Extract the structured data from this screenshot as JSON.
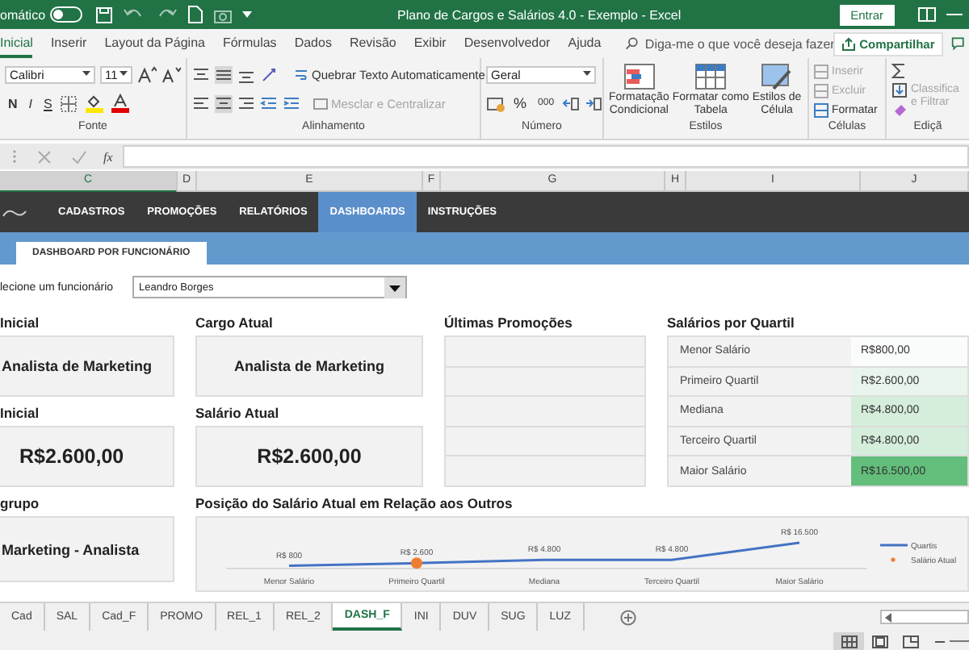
{
  "title_bar": {
    "autosave_label": "omático",
    "autosave_on": false,
    "title": "Plano de Cargos e Salários 4.0 - Exemplo  -  Excel",
    "sign_in": "Entrar"
  },
  "ribbon_tabs": [
    {
      "label": "Inicial",
      "selected": true
    },
    {
      "label": "Inserir",
      "selected": false
    },
    {
      "label": "Layout da Página",
      "selected": false
    },
    {
      "label": "Fórmulas",
      "selected": false
    },
    {
      "label": "Dados",
      "selected": false
    },
    {
      "label": "Revisão",
      "selected": false
    },
    {
      "label": "Exibir",
      "selected": false
    },
    {
      "label": "Desenvolvedor",
      "selected": false
    },
    {
      "label": "Ajuda",
      "selected": false
    }
  ],
  "tell_me": {
    "placeholder": "Diga-me o que você deseja fazer"
  },
  "share_button": "Compartilhar",
  "ribbon": {
    "font": {
      "name": "Calibri",
      "size": "11",
      "bold": "N",
      "italic": "I",
      "underline": "S",
      "label": "Fonte"
    },
    "alignment": {
      "wrap": "Quebrar Texto Automaticamente",
      "merge": "Mesclar e Centralizar",
      "merge_disabled": true,
      "label": "Alinhamento"
    },
    "number": {
      "format": "Geral",
      "percent": "%",
      "thousands": "000",
      "label": "Número"
    },
    "styles": {
      "items": [
        {
          "line1": "Formatação",
          "line2": "Condicional",
          "kind": "conditional"
        },
        {
          "line1": "Formatar como",
          "line2": "Tabela",
          "kind": "table"
        },
        {
          "line1": "Estilos de",
          "line2": "Célula",
          "kind": "cell"
        }
      ],
      "label": "Estilos"
    },
    "cells": {
      "items": [
        {
          "label": "Inserir",
          "disabled": true
        },
        {
          "label": "Excluir",
          "disabled": true
        },
        {
          "label": "Formatar",
          "disabled": false
        }
      ],
      "label": "Células"
    },
    "editing": {
      "sort_line1": "Classifica",
      "sort_line2": "e Filtrar",
      "sort_disabled": true,
      "label": "Ediçã"
    }
  },
  "formula_bar": {
    "fx": "fx"
  },
  "column_headers": [
    {
      "label": "C",
      "selected": true
    },
    {
      "label": "D",
      "selected": false
    },
    {
      "label": "E",
      "selected": false
    },
    {
      "label": "F",
      "selected": false
    },
    {
      "label": "G",
      "selected": false
    },
    {
      "label": "H",
      "selected": false
    },
    {
      "label": "I",
      "selected": false
    },
    {
      "label": "J",
      "selected": false
    }
  ],
  "nav": [
    {
      "label": "CADASTROS",
      "selected": false
    },
    {
      "label": "PROMOÇÕES",
      "selected": false
    },
    {
      "label": "RELATÓRIOS",
      "selected": false
    },
    {
      "label": "DASHBOARDS",
      "selected": true
    },
    {
      "label": "INSTRUÇÕES",
      "selected": false
    }
  ],
  "subtabs": [
    {
      "label": "DASHBOARD POR FUNCIONÁRIO",
      "selected": true
    }
  ],
  "selector": {
    "label": "lecione um funcionário",
    "value": "Leandro Borges"
  },
  "left_cards": [
    {
      "heading": "Inicial",
      "value": "Analista de Marketing",
      "kind": "text"
    },
    {
      "heading": "Inicial",
      "value": "R$2.600,00",
      "kind": "money"
    },
    {
      "heading": "grupo",
      "value": "Marketing - Analista",
      "kind": "text"
    }
  ],
  "middle_cards": [
    {
      "heading": "Cargo Atual",
      "value": "Analista de Marketing",
      "kind": "text"
    },
    {
      "heading": "Salário Atual",
      "value": "R$2.600,00",
      "kind": "money"
    }
  ],
  "promotions": {
    "heading": "Últimas Promoções"
  },
  "quartiles": {
    "heading": "Salários por Quartil",
    "rows": [
      {
        "label": "Menor Salário",
        "value": "R$800,00",
        "color": "#fafcfb"
      },
      {
        "label": "Primeiro Quartil",
        "value": "R$2.600,00",
        "color": "#e9f5ec"
      },
      {
        "label": "Mediana",
        "value": "R$4.800,00",
        "color": "#d5eddb"
      },
      {
        "label": "Terceiro Quartil",
        "value": "R$4.800,00",
        "color": "#d5eddb"
      },
      {
        "label": "Maior Salário",
        "value": "R$16.500,00",
        "color": "#63be7b"
      }
    ]
  },
  "chart": {
    "heading": "Posição do Salário Atual em Relação aos Outros",
    "chart_data": {
      "type": "line",
      "categories": [
        "Menor Salário",
        "Primeiro Quartil",
        "Mediana",
        "Terceiro Quartil",
        "Maior Salário"
      ],
      "series": [
        {
          "name": "Quartis",
          "color": "#4472c4",
          "values": [
            800,
            2600,
            4800,
            4800,
            16500
          ],
          "value_labels": [
            "R$ 800",
            "R$ 2.600",
            "R$ 4.800",
            "R$ 4.800",
            "R$ 16.500"
          ]
        },
        {
          "name": "Salário Atual",
          "color": "#ed7d31",
          "marker": true,
          "values": [
            null,
            2600,
            null,
            null,
            null
          ]
        }
      ]
    }
  },
  "sheet_tabs": [
    {
      "label": "Cad",
      "selected": false
    },
    {
      "label": "SAL",
      "selected": false
    },
    {
      "label": "Cad_F",
      "selected": false
    },
    {
      "label": "PROMO",
      "selected": false
    },
    {
      "label": "REL_1",
      "selected": false
    },
    {
      "label": "REL_2",
      "selected": false
    },
    {
      "label": "DASH_F",
      "selected": true
    },
    {
      "label": "INI",
      "selected": false
    },
    {
      "label": "DUV",
      "selected": false
    },
    {
      "label": "SUG",
      "selected": false
    },
    {
      "label": "LUZ",
      "selected": false
    }
  ],
  "views": [
    {
      "kind": "normal",
      "selected": true
    },
    {
      "kind": "page_layout",
      "selected": false
    },
    {
      "kind": "page_break",
      "selected": false
    }
  ]
}
